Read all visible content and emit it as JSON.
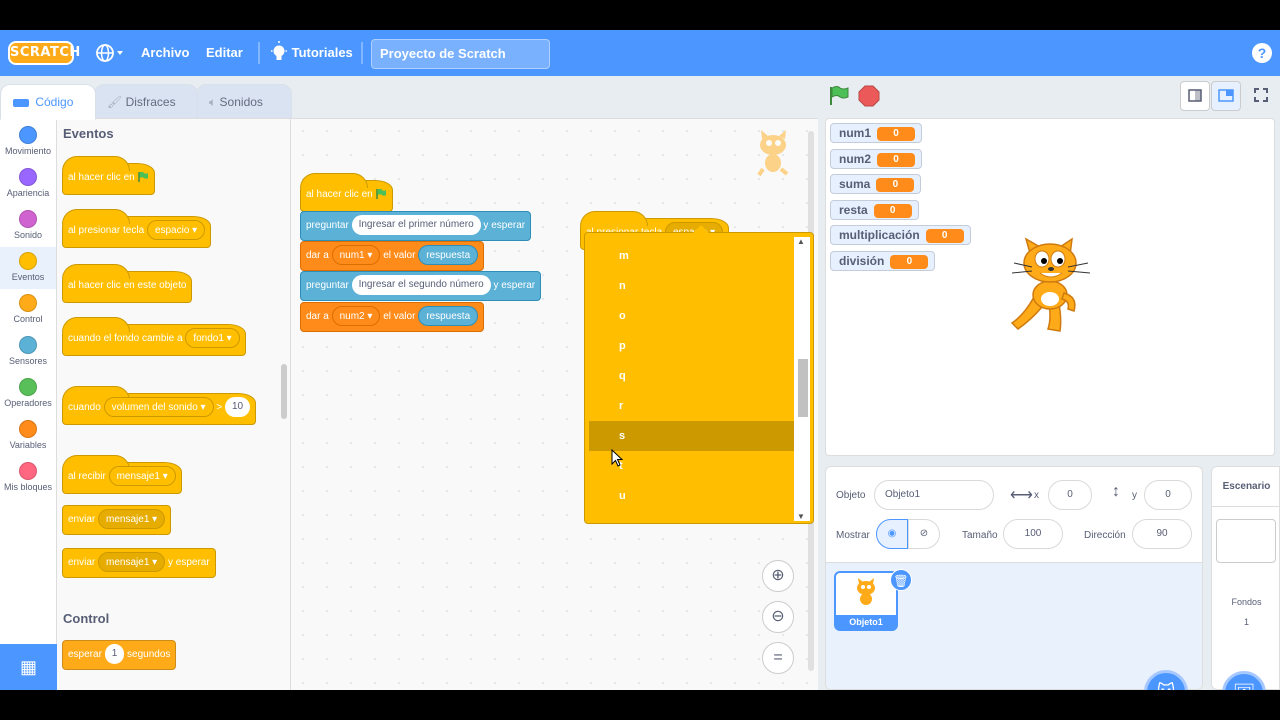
{
  "menubar": {
    "logo": "SCRATCH",
    "file": "Archivo",
    "edit": "Editar",
    "tutorials": "Tutoriales",
    "project_title": "Proyecto de Scratch",
    "help": "?"
  },
  "tabs": {
    "code": "Código",
    "costumes": "Disfraces",
    "sounds": "Sonidos"
  },
  "categories": [
    {
      "label": "Movimiento",
      "color": "#4c97ff"
    },
    {
      "label": "Apariencia",
      "color": "#9966ff"
    },
    {
      "label": "Sonido",
      "color": "#cf63cf"
    },
    {
      "label": "Eventos",
      "color": "#ffbf00"
    },
    {
      "label": "Control",
      "color": "#ffab19"
    },
    {
      "label": "Sensores",
      "color": "#5cb1d6"
    },
    {
      "label": "Operadores",
      "color": "#59c059"
    },
    {
      "label": "Variables",
      "color": "#ff8c1a"
    },
    {
      "label": "Mis bloques",
      "color": "#ff6680"
    }
  ],
  "palette": {
    "events_heading": "Eventos",
    "control_heading": "Control",
    "b_flag": "al hacer clic en",
    "b_key": "al presionar tecla",
    "b_key_val": "espacio",
    "b_sprite": "al hacer clic en este objeto",
    "b_backdrop": "cuando el fondo cambie a",
    "b_backdrop_val": "fondo1",
    "b_when": "cuando",
    "b_when_val": "volumen del sonido",
    "b_when_op": ">",
    "b_when_num": "10",
    "b_recv": "al recibir",
    "b_msg": "mensaje1",
    "b_send": "enviar",
    "b_send_wait": "y esperar",
    "b_wait": "esperar",
    "b_wait_num": "1",
    "b_wait_unit": "segundos"
  },
  "script1": {
    "hat": "al hacer clic en",
    "ask": "preguntar",
    "ask1_val": "Ingresar el primer número",
    "and_wait": "y esperar",
    "set": "dar a",
    "var1": "num1",
    "to_value": "el valor",
    "answer": "respuesta",
    "ask2_val": "Ingresar el segundo número",
    "var2": "num2"
  },
  "script2": {
    "hat": "al presionar tecla",
    "key": "espacio"
  },
  "dropdown": {
    "items": [
      "m",
      "n",
      "o",
      "p",
      "q",
      "r",
      "s",
      "t",
      "u"
    ],
    "highlighted": "s"
  },
  "monitors": [
    {
      "name": "num1",
      "value": "0"
    },
    {
      "name": "num2",
      "value": "0"
    },
    {
      "name": "suma",
      "value": "0"
    },
    {
      "name": "resta",
      "value": "0"
    },
    {
      "name": "multiplicación",
      "value": "0"
    },
    {
      "name": "división",
      "value": "0"
    }
  ],
  "sprite_info": {
    "sprite_label": "Objeto",
    "sprite_name": "Objeto1",
    "x_label": "x",
    "x": "0",
    "y_label": "y",
    "y": "0",
    "show_label": "Mostrar",
    "size_label": "Tamaño",
    "size": "100",
    "direction_label": "Dirección",
    "direction": "90"
  },
  "sprite_list": [
    {
      "name": "Objeto1"
    }
  ],
  "backdrop": {
    "title": "Escenario",
    "label": "Fondos",
    "count": "1"
  },
  "colors": {
    "accent": "#4c97ff",
    "events": "#ffbf00",
    "variables": "#ff8c1a",
    "sensing": "#5cb1d6"
  }
}
